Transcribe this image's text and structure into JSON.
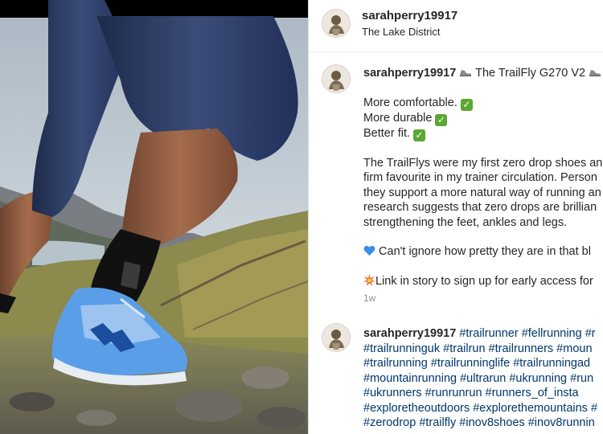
{
  "post": {
    "username": "sarahperry19917",
    "location": "The Lake District"
  },
  "caption": {
    "username": "sarahperry19917",
    "title": "The TrailFly G270 V2",
    "lines": [
      "More comfortable.",
      "More durable",
      "Better fit."
    ],
    "paragraph": [
      "The TrailFlys were my first zero drop shoes an",
      "firm favourite in my trainer circulation. Person",
      "they support a more natural way of running an",
      "research suggests that zero drops are brillian",
      "strengthening the feet, ankles and legs."
    ],
    "heart_line": "Can't ignore how pretty they are in that bl",
    "link_line": "Link in story to sign up for early access for",
    "time": "1w"
  },
  "comment": {
    "username": "sarahperry19917",
    "first_line_tags": "#trailrunner #fellrunning #r",
    "lines": [
      "#trailrunninguk #trailrun #trailrunners #moun",
      "#trailrunning #trailrunninglife #trailrunningad",
      "#mountainrunning #ultrarun #ukrunning #run",
      "#ukrunners #runrunrun #runners_of_insta",
      "#exploretheoutdoors #explorethemountains #",
      "#zerodrop #trailfly #inov8shoes #inov8runnin"
    ]
  },
  "icons": {
    "check": "check-mark-icon",
    "shoe": "running-shoe-icon",
    "heart": "blue-heart-icon",
    "spark": "collision-spark-icon"
  },
  "colors": {
    "check_green": "#5aa832",
    "hashtag_blue": "#00376b",
    "heart_blue": "#3e8ee8",
    "shoe_blue": "#5b9ee8"
  }
}
